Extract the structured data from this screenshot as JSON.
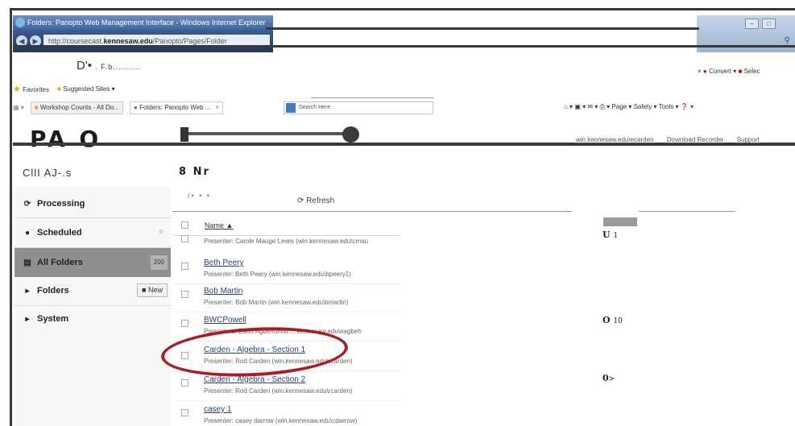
{
  "browser": {
    "window_title": "Folders: Panopto Web Management Interface - Windows Internet Explorer",
    "url_prefix": "http://coursecast.",
    "url_host": "kennesaw.edu",
    "url_path": "/Panopto/Pages/Folder",
    "address_text": "D'•",
    "address_sub": ". F.b..........",
    "convert_label": "Convert",
    "select_label": "Selec",
    "favorites_label": "Favorites",
    "suggested_sites_label": "Suggested Sites",
    "tabs": [
      {
        "label": "Workshop Counts - All Do...",
        "active": false
      },
      {
        "label": "Folders: Panopto Web ...",
        "active": true
      }
    ],
    "tab_close_glyph": "×",
    "search_placeholder": "Search Here",
    "command_bar": [
      "Page",
      "Safety",
      "Tools"
    ]
  },
  "header": {
    "logo_text": "PA O",
    "user_links": [
      "win.kennesaw.edu\\ecarden",
      "Download Recorder",
      "Support"
    ]
  },
  "sidebar": {
    "heading": "CllI AJ-.s",
    "items": [
      {
        "label": "Processing",
        "icon": "processing-icon",
        "selected": false
      },
      {
        "label": "Scheduled",
        "icon": "clock-icon",
        "selected": false,
        "extra": "0"
      },
      {
        "label": "All Folders",
        "icon": "folders-icon",
        "selected": true,
        "count": "200"
      },
      {
        "label": "Folders",
        "icon": "triangle-right-icon",
        "selected": false,
        "button": "New"
      },
      {
        "label": "System",
        "icon": "triangle-right-icon",
        "selected": false
      }
    ]
  },
  "main": {
    "title": "8 Nr",
    "toolbar_dots": "/• • •",
    "refresh_label": "Refresh",
    "column_name": "Name ▲",
    "partial_presenter": "Presenter: Carole Mauge Lewis (win.kennesaw.edu\\cmau",
    "sessions": [
      {
        "title": "Beth Peery",
        "presenter": "Presenter: Beth Peery (win.kennesaw.edu\\bpeery1)"
      },
      {
        "title": "Bob Martin",
        "presenter": "Presenter: Bob Martin (win.kennesaw.edu\\bmartin)"
      },
      {
        "title": "BWCPowell",
        "presenter": "Presenters: Edoh Agbehonou ... kennesaw.edu\\eagbeh"
      },
      {
        "title": "Carden - Algebra - Section 1",
        "presenter": "Presenter: Rod Carden (win.kennesaw.edu\\rcarden)"
      },
      {
        "title": "Carden - Algebra - Section 2",
        "presenter": "Presenter: Rod Carden (win.kennesaw.edu\\rcarden)"
      },
      {
        "title": "casey 1",
        "presenter": "Presenter: casey darrow (win.kennesaw.edu\\cdarrow)"
      }
    ]
  },
  "right_column": [
    {
      "main": "U",
      "sub": "1"
    },
    {
      "main": "O",
      "sub": "10"
    },
    {
      "main": "0",
      "sub": ">"
    }
  ],
  "colors": {
    "highlight_ellipse": "#a91e23",
    "selected_sidebar": "#8f8f8f",
    "link": "#2a3f7a"
  }
}
